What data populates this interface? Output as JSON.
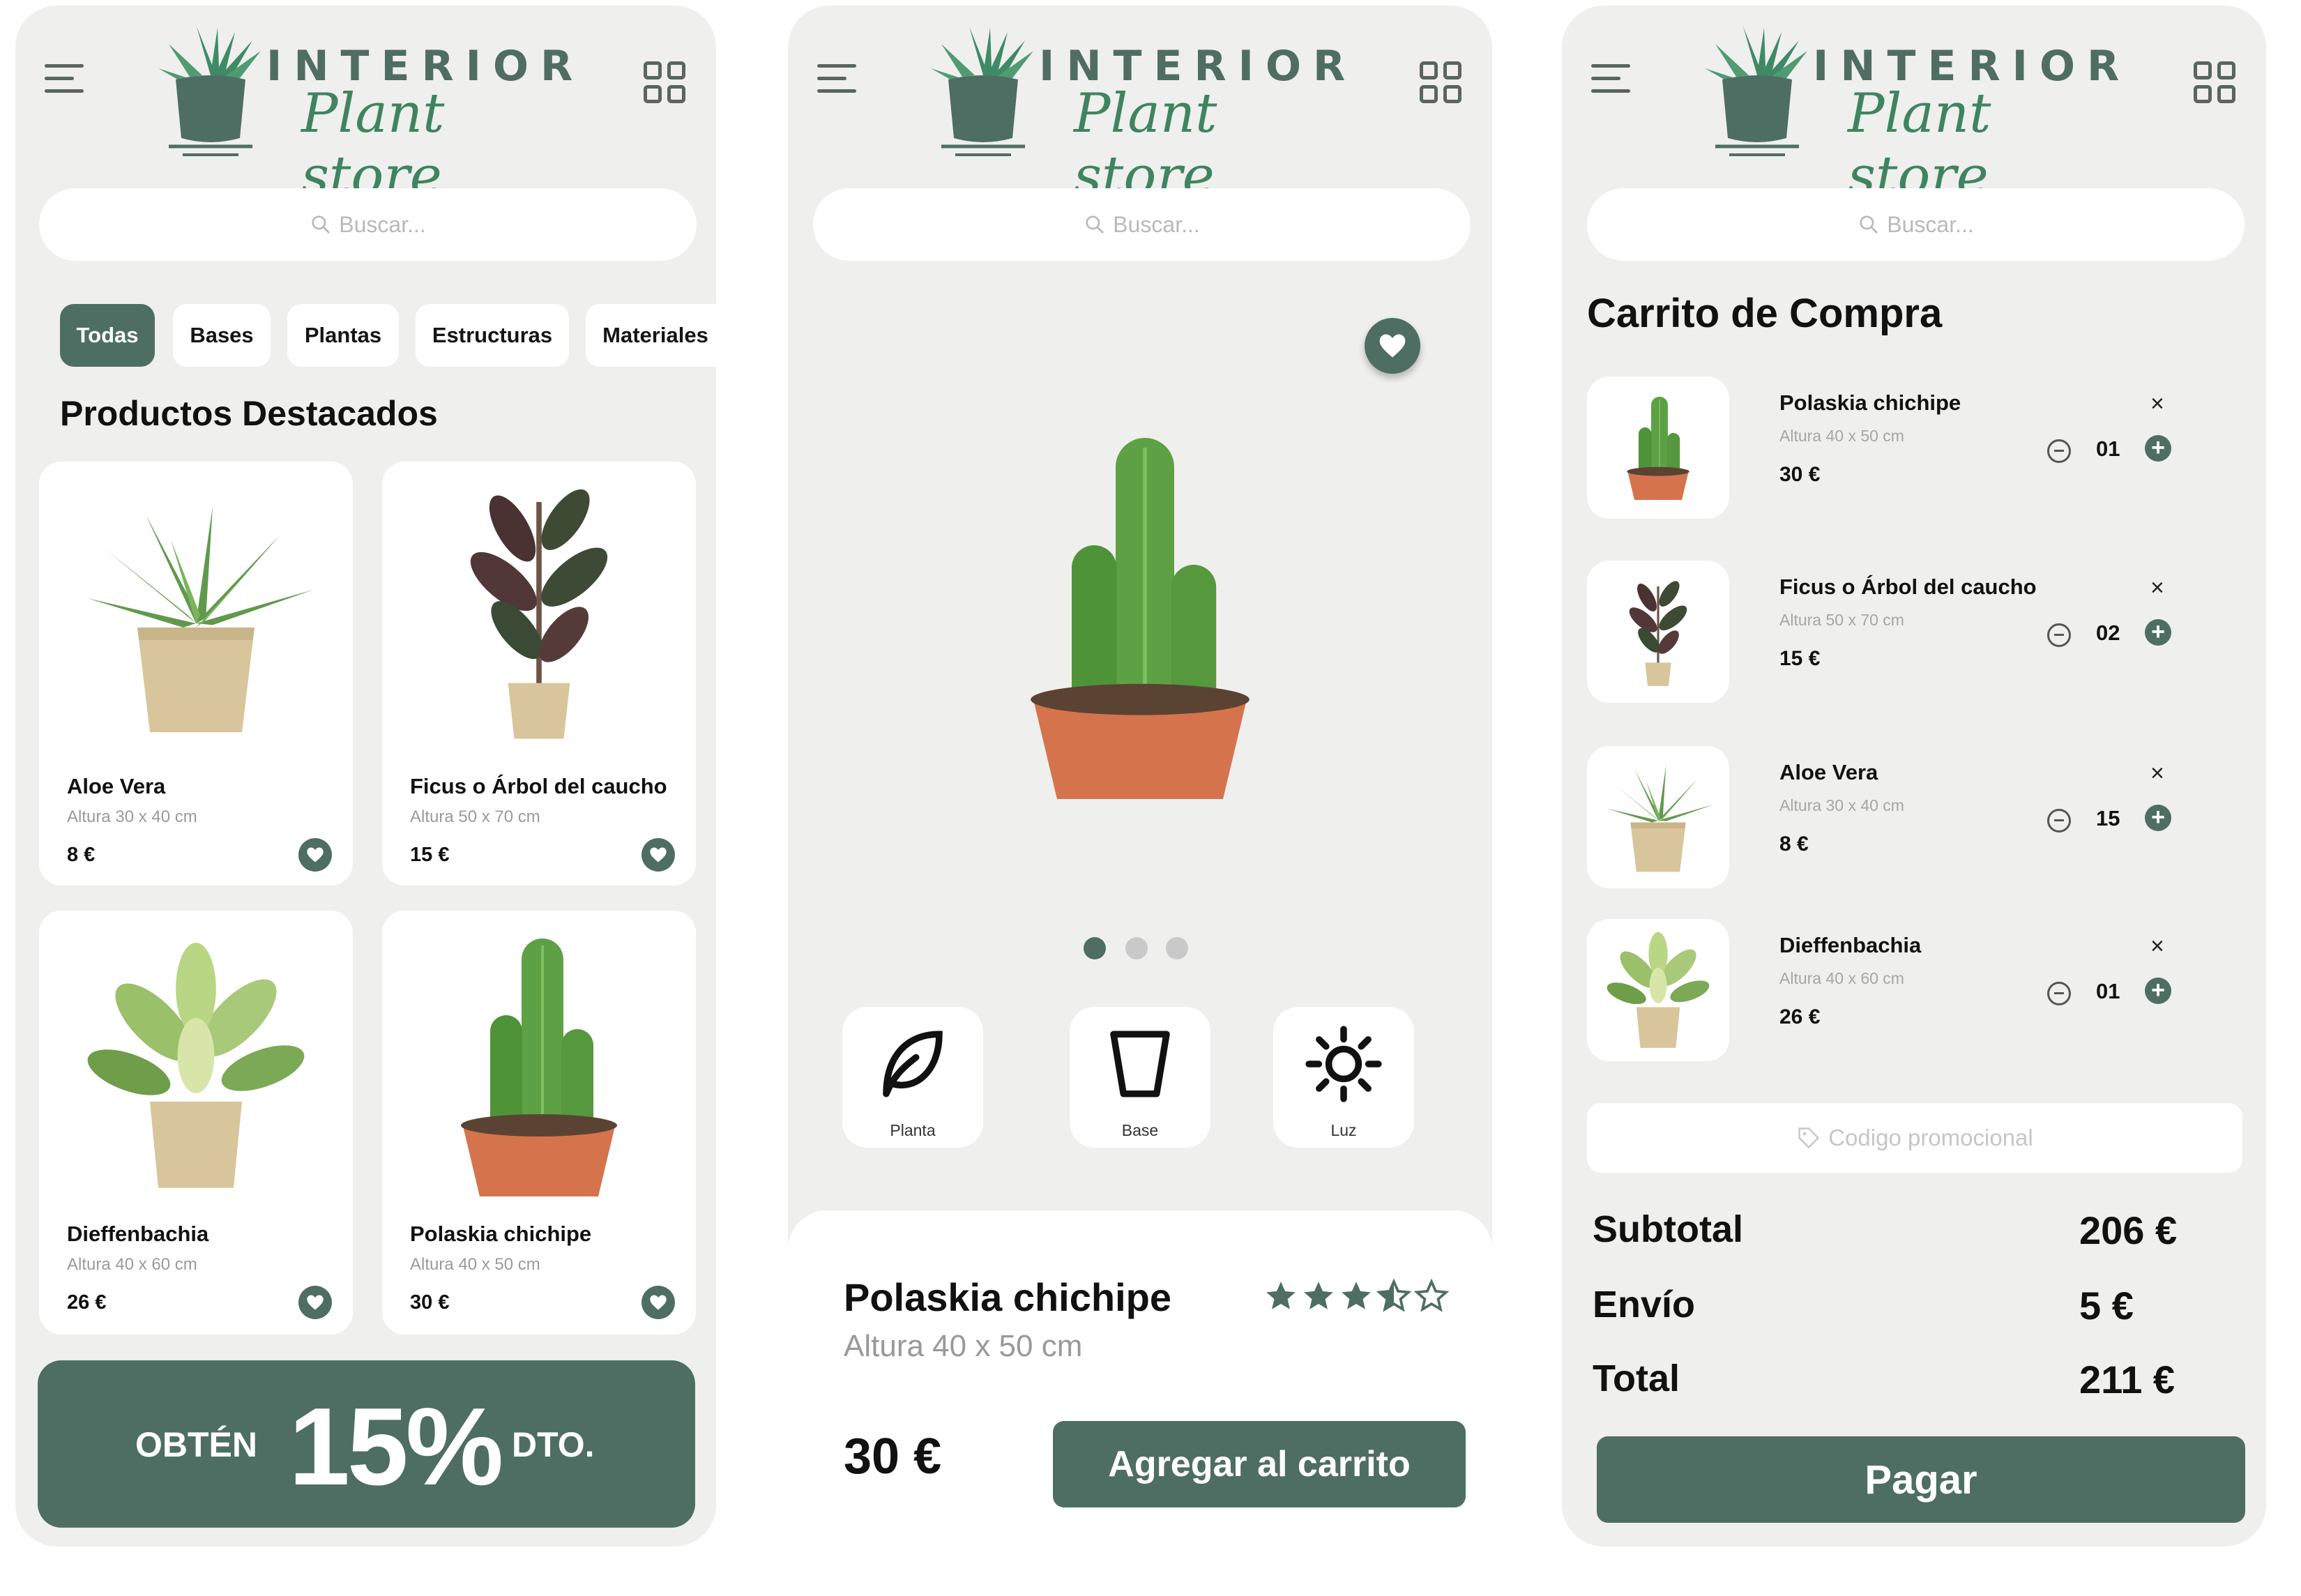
{
  "brand": {
    "title": "INTERIOR",
    "script": "Plant store"
  },
  "search": {
    "placeholder": "Buscar..."
  },
  "colors": {
    "accent": "#4e6e64",
    "background": "#efefed",
    "card": "#ffffff"
  },
  "screen1": {
    "categories": [
      "Todas",
      "Bases",
      "Plantas",
      "Estructuras",
      "Materiales"
    ],
    "active_category": "Todas",
    "section_title": "Productos Destacados",
    "products": [
      {
        "name": "Aloe Vera",
        "dims": "Altura 30 x 40 cm",
        "price": "8 €",
        "icon": "aloe-plant"
      },
      {
        "name": "Ficus o Árbol del caucho",
        "dims": "Altura 50 x 70 cm",
        "price": "15 €",
        "icon": "ficus-plant"
      },
      {
        "name": "Dieffenbachia",
        "dims": "Altura 40 x 60 cm",
        "price": "26 €",
        "icon": "dieffenbachia-plant"
      },
      {
        "name": "Polaskia chichipe",
        "dims": "Altura 40 x 50 cm",
        "price": "30 €",
        "icon": "cactus-plant"
      }
    ],
    "promo": {
      "left": "OBTÉN",
      "big": "15%",
      "right": "DTO."
    }
  },
  "screen2": {
    "carousel": {
      "count": 3,
      "active": 0
    },
    "features": [
      {
        "label": "Planta",
        "icon": "leaf-icon"
      },
      {
        "label": "Base",
        "icon": "pot-icon"
      },
      {
        "label": "Luz",
        "icon": "sun-icon"
      }
    ],
    "product": {
      "name": "Polaskia chichipe",
      "dims": "Altura 40 x 50 cm",
      "price": "30 €",
      "rating": 3.5,
      "rating_max": 5
    },
    "add_button": "Agregar al carrito"
  },
  "screen3": {
    "title": "Carrito de Compra",
    "items": [
      {
        "name": "Polaskia chichipe",
        "dims": "Altura 40 x 50 cm",
        "price": "30 €",
        "qty": "01",
        "remove": "×"
      },
      {
        "name": "Ficus o Árbol del caucho",
        "dims": "Altura 50 x 70 cm",
        "price": "15 €",
        "qty": "02",
        "remove": "×"
      },
      {
        "name": "Aloe Vera",
        "dims": "Altura 30 x 40 cm",
        "price": "8 €",
        "qty": "15",
        "remove": "×"
      },
      {
        "name": "Dieffenbachia",
        "dims": "Altura 40 x 60 cm",
        "price": "26 €",
        "qty": "01",
        "remove": "×"
      }
    ],
    "coupon_placeholder": "Codigo promocional",
    "summary": [
      {
        "label": "Subtotal",
        "value": "206 €"
      },
      {
        "label": "Envío",
        "value": "5 €"
      },
      {
        "label": "Total",
        "value": "211 €"
      }
    ],
    "pay_button": "Pagar"
  }
}
